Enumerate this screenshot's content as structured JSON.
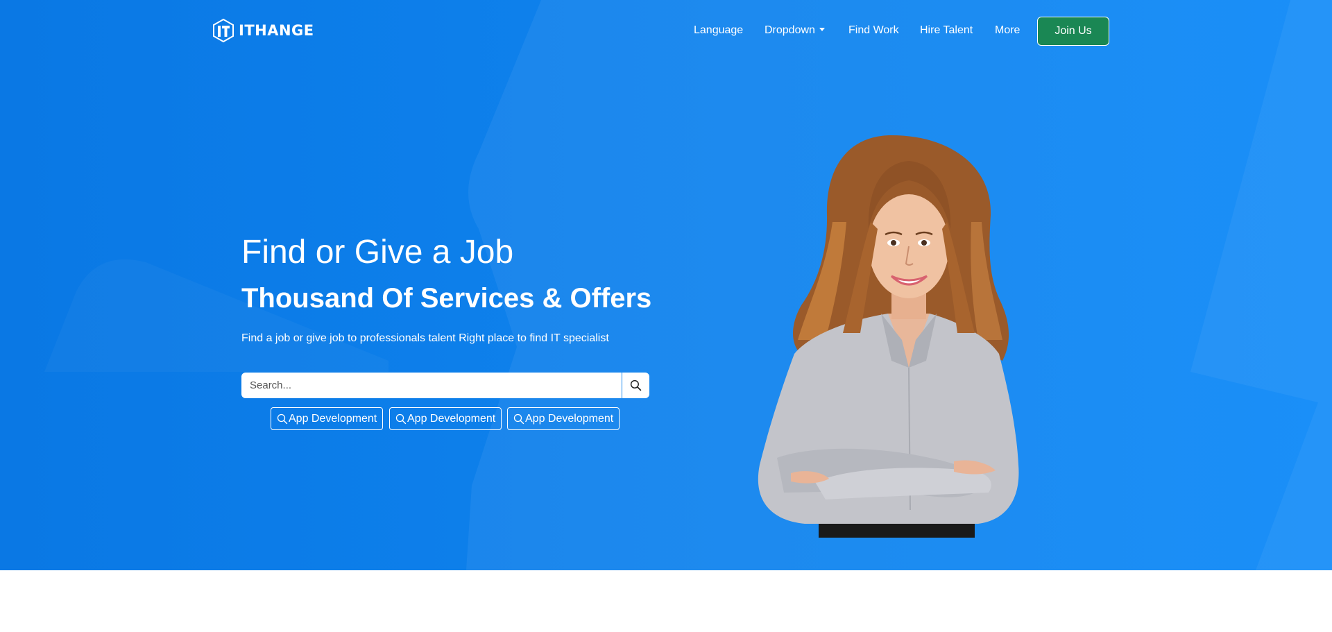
{
  "brand": {
    "name": "ITHANGE",
    "logo_icon": "it-logo-icon"
  },
  "nav": {
    "items": [
      {
        "label": "Language"
      },
      {
        "label": "Dropdown",
        "has_caret": true
      },
      {
        "label": "Find Work"
      },
      {
        "label": "Hire Talent"
      },
      {
        "label": "More"
      }
    ],
    "join_label": "Join Us"
  },
  "hero": {
    "title": "Find or Give a Job",
    "subtitle": "Thousand Of Services & Offers",
    "lead": "Find a job or give job to professionals talent Right place to find IT specialist",
    "search": {
      "placeholder": "Search...",
      "button_icon": "search-icon"
    },
    "tags": [
      {
        "label": "App Development"
      },
      {
        "label": "App Development"
      },
      {
        "label": "App Development"
      }
    ],
    "image_alt": "Smiling woman with crossed arms"
  },
  "colors": {
    "hero_blue": "#0f83ee",
    "join_green": "#1a8754",
    "text_white": "#ffffff"
  }
}
